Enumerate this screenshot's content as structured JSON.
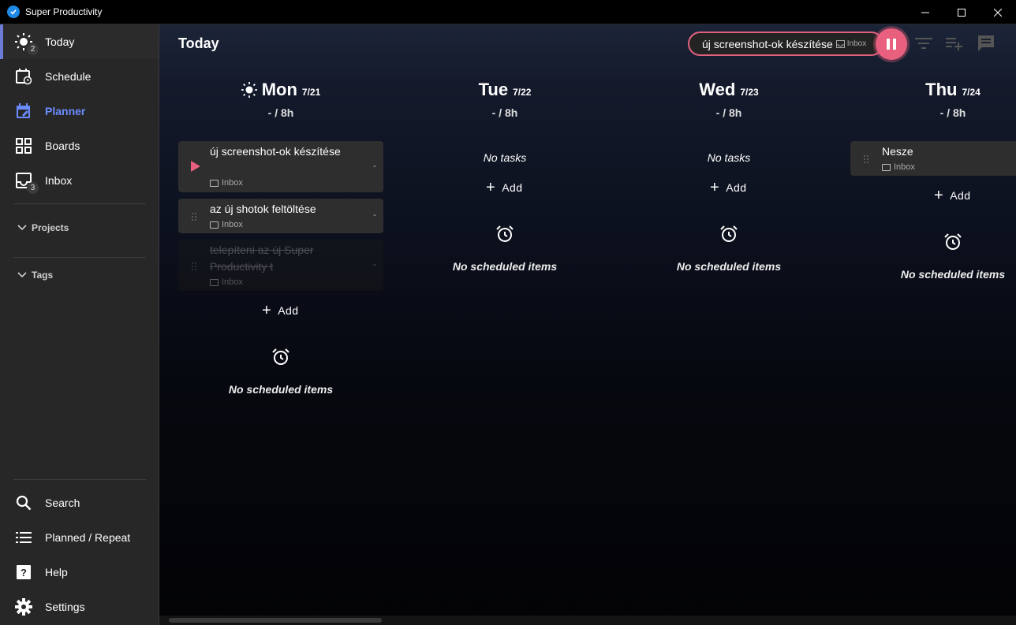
{
  "window": {
    "title": "Super Productivity"
  },
  "sidebar": {
    "items": [
      {
        "label": "Today",
        "badge": "2",
        "icon": "sun-icon"
      },
      {
        "label": "Schedule",
        "icon": "calendar-clock-icon"
      },
      {
        "label": "Planner",
        "icon": "calendar-edit-icon"
      },
      {
        "label": "Boards",
        "icon": "grid-icon"
      },
      {
        "label": "Inbox",
        "badge": "3",
        "icon": "inbox-icon"
      }
    ],
    "sections": {
      "projects": "Projects",
      "tags": "Tags"
    },
    "bottom": [
      {
        "label": "Search",
        "icon": "search-icon"
      },
      {
        "label": "Planned / Repeat",
        "icon": "list-icon"
      },
      {
        "label": "Help",
        "icon": "help-icon"
      },
      {
        "label": "Settings",
        "icon": "gear-icon"
      }
    ]
  },
  "header": {
    "title": "Today",
    "current_task": "új screenshot-ok készítése",
    "current_task_tag": "Inbox"
  },
  "days": [
    {
      "name": "Mon",
      "date": "7/21",
      "estimate": "- / 8h",
      "tasks": [
        {
          "title": "új screenshot-ok készítése",
          "project": "Inbox",
          "time": "-"
        },
        {
          "title": "az új shotok feltöltése",
          "project": "Inbox",
          "time": "-"
        },
        {
          "title": "telepíteni az új Super Productivity t",
          "project": "Inbox",
          "time": "-"
        }
      ],
      "add_label": "Add",
      "no_scheduled": "No scheduled items"
    },
    {
      "name": "Tue",
      "date": "7/22",
      "estimate": "- / 8h",
      "no_tasks": "No tasks",
      "add_label": "Add",
      "no_scheduled": "No scheduled items"
    },
    {
      "name": "Wed",
      "date": "7/23",
      "estimate": "- / 8h",
      "no_tasks": "No tasks",
      "add_label": "Add",
      "no_scheduled": "No scheduled items"
    },
    {
      "name": "Thu",
      "date": "7/24",
      "estimate": "- / 8h",
      "tasks": [
        {
          "title": "Nesze",
          "project": "Inbox"
        }
      ],
      "add_label": "Add",
      "no_scheduled": "No scheduled items"
    }
  ],
  "colors": {
    "accent": "#e8607e",
    "planner_active": "#6b8cff"
  }
}
